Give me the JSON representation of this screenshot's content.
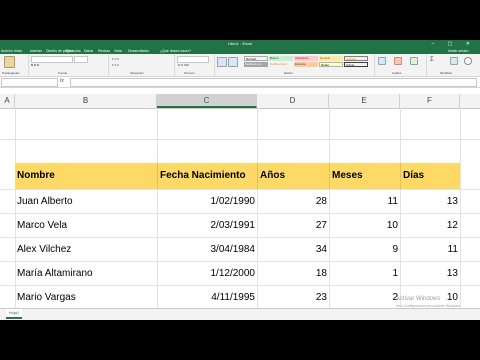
{
  "window": {
    "title": "Libro1 - Excel",
    "tabs": [
      "Archivo",
      "Inicio",
      "Insertar",
      "Diseño de página",
      "Fórmulas",
      "Datos",
      "Revisar",
      "Vista",
      "Desarrollador",
      "¿Qué desea hacer?"
    ],
    "user": "Iniciar sesión"
  },
  "ribbon": {
    "styles": [
      "Normal",
      "Bueno",
      "Incorrecto",
      "Neutral",
      "Cálculo",
      "Celda de co...",
      "Celda vincul...",
      "Entrada",
      "Notas",
      "Salida"
    ],
    "groups": [
      "Portapapeles",
      "Fuente",
      "Alineación",
      "Número",
      "Estilos",
      "Celdas",
      "Modificar"
    ],
    "style_colors": {
      "Normal": "#ffffff",
      "Bueno": "#c6efce",
      "Incorrecto": "#ffc7ce",
      "Neutral": "#ffeb9c",
      "Cálculo": "#f2f2f2",
      "Celda de co...": "#a5a5a5",
      "Celda vincul...": "#ffffff",
      "Entrada": "#ffcc99",
      "Notas": "#ffffcc",
      "Salida": "#f2f2f2"
    }
  },
  "columns": [
    "A",
    "B",
    "C",
    "D",
    "E",
    "F"
  ],
  "selected_column": "C",
  "table": {
    "headers": [
      "Nombre",
      "Fecha Nacimiento",
      "Años",
      "Meses",
      "Días"
    ],
    "rows": [
      [
        "Juan Alberto",
        "1/02/1990",
        "28",
        "11",
        "13"
      ],
      [
        "Marco Vela",
        "2/03/1991",
        "27",
        "10",
        "12"
      ],
      [
        "Alex Vilchez",
        "3/04/1984",
        "34",
        "9",
        "11"
      ],
      [
        "María Altamirano",
        "1/12/2000",
        "18",
        "1",
        "13"
      ],
      [
        "Mario Vargas",
        "4/11/1995",
        "23",
        "2",
        "10"
      ]
    ]
  },
  "sheet": {
    "tab": "Hoja1"
  },
  "watermark": {
    "line1": "Activar Windows",
    "line2": "Ve a Configuración para activar Windows."
  },
  "colors": {
    "accent": "#217346",
    "header_fill": "#ffd966"
  }
}
